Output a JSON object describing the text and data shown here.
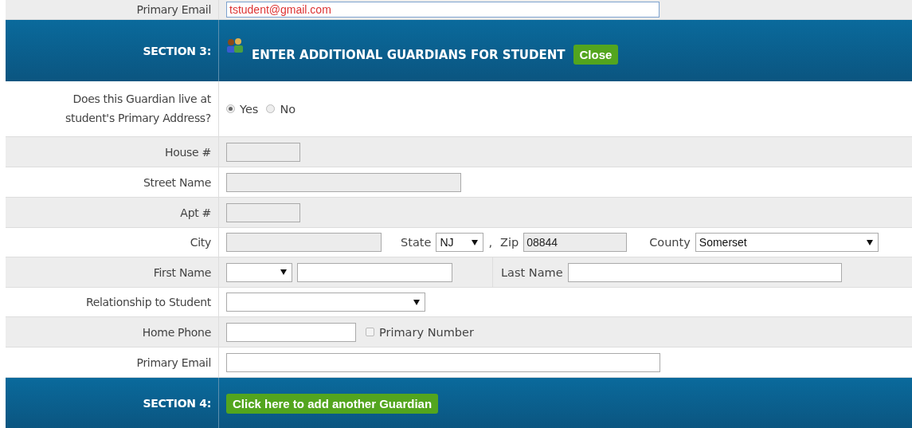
{
  "top_row": {
    "label": "Primary Email",
    "value": "tstudent@gmail.com"
  },
  "section_3": {
    "label": "SECTION 3:",
    "title": "ENTER ADDITIONAL GUARDIANS FOR STUDENT",
    "button": "Close"
  },
  "rows": [
    {
      "label": "Does this Guardian live at student's Primary Address?",
      "items": [
        {
          "kind": "radio",
          "label": "Yes",
          "selected": true
        },
        {
          "kind": "radio",
          "label": "No",
          "selected": false
        }
      ]
    },
    {
      "label": "House #",
      "items": [
        {
          "kind": "field",
          "disabled": true
        }
      ]
    },
    {
      "label": "Street Name",
      "items": [
        {
          "kind": "field",
          "disabled": true
        }
      ]
    },
    {
      "label": "Apt #",
      "items": [
        {
          "kind": "field",
          "disabled": true
        }
      ]
    },
    {
      "label": "City",
      "items": [
        {
          "kind": "field",
          "disabled": true
        },
        {
          "kind": "text",
          "label": "State"
        },
        {
          "kind": "select",
          "value": "NJ"
        },
        {
          "kind": "text",
          "label": ","
        },
        {
          "kind": "text",
          "label": "Zip"
        },
        {
          "kind": "field",
          "value": "08844",
          "disabled": true
        },
        {
          "kind": "text",
          "label": "County"
        },
        {
          "kind": "select",
          "value": "Somerset"
        }
      ]
    },
    {
      "label": "First Name",
      "items": [
        {
          "kind": "select"
        },
        {
          "kind": "field",
          "disabled": false
        },
        {
          "kind": "cell-label",
          "label": "Last Name"
        },
        {
          "kind": "field",
          "disabled": false
        }
      ]
    },
    {
      "label": "Relationship to Student",
      "items": [
        {
          "kind": "select"
        }
      ]
    },
    {
      "label": "Home Phone",
      "items": [
        {
          "kind": "field",
          "disabled": false
        },
        {
          "kind": "checkbox",
          "label": "Primary Number",
          "checked": false
        }
      ]
    },
    {
      "label": "Primary Email",
      "items": [
        {
          "kind": "field",
          "disabled": false
        }
      ]
    }
  ],
  "section_4": {
    "label": "SECTION 4:",
    "button": "Click here to add another Guardian"
  }
}
